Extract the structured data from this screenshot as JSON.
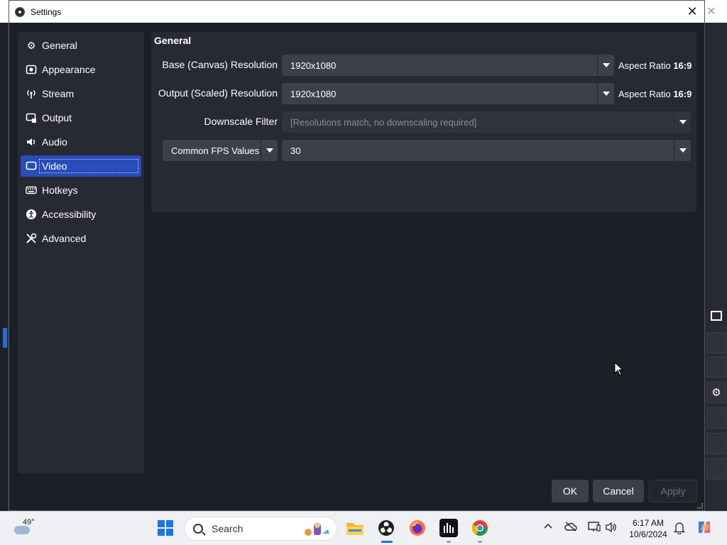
{
  "dialog": {
    "title": "Settings"
  },
  "sidebar": {
    "items": [
      {
        "label": "General",
        "icon": "gear-icon"
      },
      {
        "label": "Appearance",
        "icon": "appearance-icon"
      },
      {
        "label": "Stream",
        "icon": "antenna-icon"
      },
      {
        "label": "Output",
        "icon": "output-icon"
      },
      {
        "label": "Audio",
        "icon": "speaker-icon"
      },
      {
        "label": "Video",
        "icon": "monitor-icon"
      },
      {
        "label": "Hotkeys",
        "icon": "keyboard-icon"
      },
      {
        "label": "Accessibility",
        "icon": "accessibility-icon"
      },
      {
        "label": "Advanced",
        "icon": "tools-icon"
      }
    ],
    "active": "Video"
  },
  "general": {
    "section_title": "General",
    "base_label": "Base (Canvas) Resolution",
    "base_value": "1920x1080",
    "base_aspect_label": "Aspect Ratio",
    "base_aspect_value": "16:9",
    "output_label": "Output (Scaled) Resolution",
    "output_value": "1920x1080",
    "output_aspect_label": "Aspect Ratio",
    "output_aspect_value": "16:9",
    "downscale_label": "Downscale Filter",
    "downscale_value": "[Resolutions match, no downscaling required]",
    "fps_type": "Common FPS Values",
    "fps_value": "30"
  },
  "buttons": {
    "ok": "OK",
    "cancel": "Cancel",
    "apply": "Apply"
  },
  "taskbar": {
    "weather_temp": "49°",
    "search_placeholder": "Search",
    "time": "6:17 AM",
    "date": "10/6/2024"
  },
  "colors": {
    "dialog_bg": "#1d1f26",
    "panel_bg": "#272a33",
    "accent": "#284cb8",
    "combo_bg": "#3c404b"
  }
}
